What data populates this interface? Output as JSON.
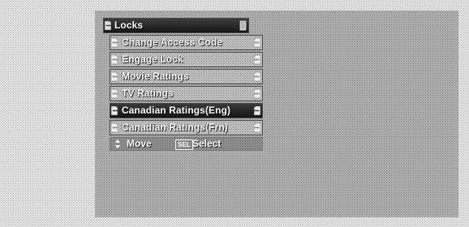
{
  "menu": {
    "title": "Locks",
    "items": [
      {
        "label": "Change Access Code",
        "selected": false
      },
      {
        "label": "Engage Lock",
        "selected": false
      },
      {
        "label": "Movie Ratings",
        "selected": false
      },
      {
        "label": "TV Ratings",
        "selected": false
      },
      {
        "label": "Canadian Ratings(Eng)",
        "selected": true
      },
      {
        "label": "Canadian Ratings(Frn)",
        "selected": false
      }
    ]
  },
  "footer": {
    "move_label": "Move",
    "sel_key_label": "SEL",
    "select_label": "Select"
  },
  "icons": {
    "tab_left": "left-tab-marker-icon",
    "tab_right": "right-tab-marker-icon",
    "updown": "updown-arrows-icon",
    "sel_key": "sel-key-icon"
  }
}
